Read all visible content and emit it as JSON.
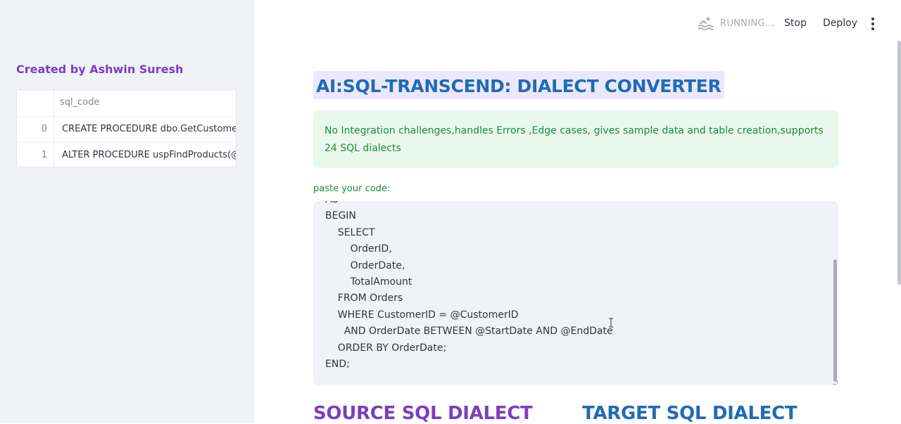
{
  "sidebar": {
    "title": "Created by Ashwin Suresh",
    "dataframe": {
      "column": "sql_code",
      "rows": [
        {
          "index": "0",
          "value": "CREATE PROCEDURE dbo.GetCustomerSa"
        },
        {
          "index": "1",
          "value": "ALTER PROCEDURE uspFindProducts(@m"
        }
      ]
    }
  },
  "toolbar": {
    "status_icon": "running-swimmer-icon",
    "status": "RUNNING...",
    "stop_label": "Stop",
    "deploy_label": "Deploy",
    "menu_icon": "vertical-dots-icon"
  },
  "main": {
    "title": "AI:SQL-TRANSCEND: DIALECT CONVERTER",
    "info": "No Integration challenges,handles Errors ,Edge cases, gives sample data and table creation,supports 24 SQL dialects",
    "code_label": "paste your code:",
    "code": "AS\nBEGIN\n    SELECT\n        OrderID,\n        OrderDate,\n        TotalAmount\n    FROM Orders\n    WHERE CustomerID = @CustomerID\n      AND OrderDate BETWEEN @StartDate AND @EndDate\n    ORDER BY OrderDate;\nEND;",
    "source_heading": "SOURCE SQL DIALECT",
    "target_heading": "TARGET SQL DIALECT"
  },
  "colors": {
    "sidebar_bg": "#f0f2f6",
    "purple_accent": "#7b3fbf",
    "blue_accent": "#1f6bb6",
    "success_green": "#1f8a3e",
    "success_bg": "#e9f8ec"
  }
}
